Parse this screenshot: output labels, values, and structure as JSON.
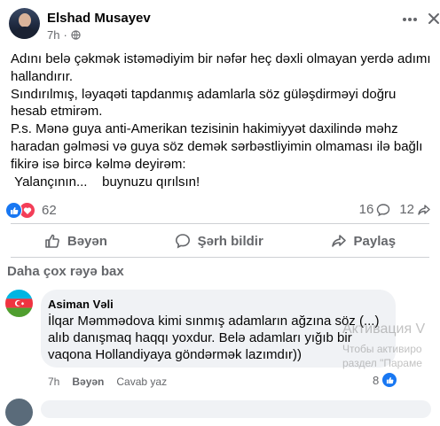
{
  "post": {
    "author": "Elshad Musayev",
    "time": "7h",
    "privacy_icon": "globe-icon",
    "paragraphs": [
      "Adını belə çəkmək istəmədiyim bir nəfər heç dəxli olmayan yerdə adımı hallandırır.",
      "Sındırılmış, ləyaqəti tapdanmış adamlarla söz güləşdirməyi doğru hesab etmirəm.",
      "P.s. Mənə guya anti-Amerikan tezisinin hakimiyyət daxilində məhz haradan gəlməsi və guya söz demək sərbəstliyimin olmaması ilə bağlı fikirə isə bircə kəlmə deyirəm:",
      " Yalançının...    buynuzu qırılsın!"
    ],
    "reaction_count": "62",
    "comment_count": "16",
    "share_count": "12"
  },
  "actions": {
    "like": "Bəyən",
    "comment": "Şərh bildir",
    "share": "Paylaş"
  },
  "comments": {
    "more_label": "Daha çox rəyə bax",
    "items": [
      {
        "name": "Asiman Vəli",
        "text": "İlqar Məmmədova kimi sınmış adamların ağzına söz (...) alıb danışmaq haqqı yoxdur. Belə adamları yığıb bir vaqona Hollandiyaya göndərmək lazımdır))",
        "time": "7h",
        "like_label": "Bəyən",
        "reply_label": "Cavab yaz",
        "reaction_count": "8"
      }
    ]
  },
  "watermark": {
    "line1": "Активация V",
    "line2": "Чтобы активиро",
    "line3": "раздел \"Параме"
  },
  "colors": {
    "accent": "#1877f2",
    "love": "#f33e58",
    "secondary_text": "#65676b",
    "bubble": "#f0f2f5"
  }
}
